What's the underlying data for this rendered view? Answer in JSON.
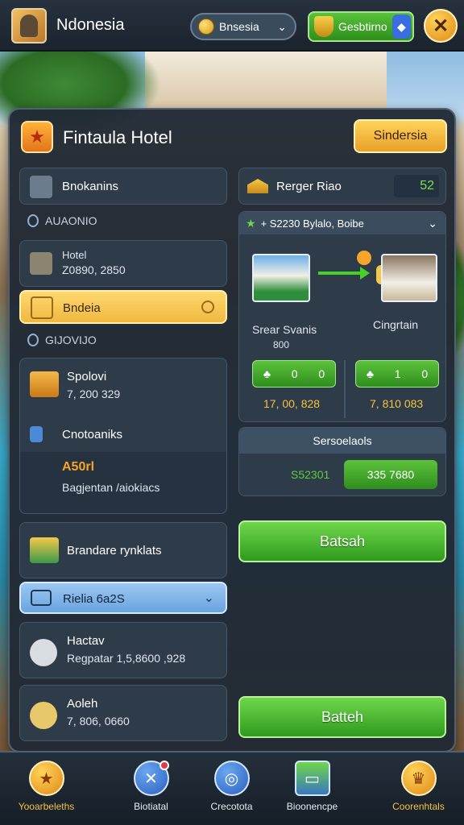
{
  "header": {
    "app_title": "Ndonesia",
    "language_selector": "Bnsesia",
    "green_badge": "Gesbtirno"
  },
  "panel": {
    "title": "Fintaula Hotel",
    "top_button": "Sindersia"
  },
  "left": {
    "bookings_label": "Bnokanins",
    "section1_label": "AUAONIO",
    "hotel_card": {
      "title": "Hotel",
      "value": "Z0890, 2850"
    },
    "yellow_item": "Bndeia",
    "section2_label": "GIJOVIJO",
    "spolovi": {
      "title": "Spolovi",
      "value": "7, 200 329"
    },
    "cnotoaniks_label": "Cnotoaniks",
    "promo": {
      "title": "A50rl",
      "subtitle": "Bagjentan /aiokiacs"
    },
    "brandare_label": "Brandare rynklats",
    "blue_selector": "Rielia 6a2S",
    "hactav": {
      "title": "Hactav",
      "value": "Regpatar 1,5,8600 ,928"
    },
    "aoleh": {
      "title": "Aoleh",
      "value": "7, 806, 0660"
    }
  },
  "right": {
    "region_label": "Rerger Riao",
    "region_value": "52",
    "dropdown_label": "+ S2230 Bylalo, Boibe",
    "room_from": {
      "name": "Srear Svanis",
      "sub": "800"
    },
    "room_to": {
      "name": "Cingrtain"
    },
    "pill_left": {
      "a": "0",
      "b": "0"
    },
    "pill_right": {
      "a": "1",
      "b": "0"
    },
    "price_left": "17, 00, 828",
    "price_right": "7, 810 083",
    "summary_title": "Sersoelaols",
    "summary_left": "S52301",
    "summary_right": "335 7680",
    "primary_button": "Batsah",
    "secondary_button": "Batteh"
  },
  "nav": [
    {
      "label": "Yooarbeleths",
      "icon": "star-icon"
    },
    {
      "label": "Biotiatal",
      "icon": "tools-icon"
    },
    {
      "label": "Crecotota",
      "icon": "globe-icon"
    },
    {
      "label": "Bioonencpe",
      "icon": "chest-icon"
    },
    {
      "label": "Coorenhtals",
      "icon": "crown-icon"
    }
  ],
  "colors": {
    "accent_gold": "#f0b840",
    "accent_green": "#3fae2a",
    "panel_bg": "#212a34"
  }
}
